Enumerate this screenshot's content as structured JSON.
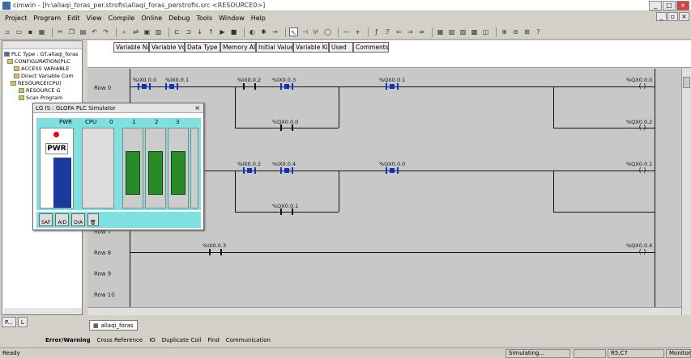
{
  "window": {
    "title": "cimwin - [h:\\allaqi_foras_per.strofis\\allaqi_foras_perstrofis.src <RESOURCE0>]"
  },
  "menu": [
    "Project",
    "Program",
    "Edit",
    "View",
    "Compile",
    "Online",
    "Debug",
    "Tools",
    "Window",
    "Help"
  ],
  "tree": {
    "nodes": [
      "PLC Type : GT.allaqi_foras",
      "CONFIGURATION(PLC",
      "ACCESS VARIABLE",
      "Direct Variable Com",
      "RESOURCE(CPU)",
      "RESOURCE G",
      "Scan Program"
    ],
    "tabs": [
      "P...",
      "L"
    ]
  },
  "header_cols": [
    "Variable Na",
    "Variable Vc",
    "Data Type",
    "Memory Al",
    "Initial Value",
    "Variable Ki",
    "Used",
    "Comments"
  ],
  "ladder": {
    "rungs": [
      "Row 0",
      "Row 7",
      "Row 8",
      "Row 9",
      "Row 10"
    ],
    "labels": {
      "r0_c1": "%IX0.0.0",
      "r0_c2": "%IX0.0.1",
      "r0_c3": "%IX0.0.2",
      "r0_c4": "%IX0.0.3",
      "r0_c5": "%QX0.0.1",
      "r0_coil": "%QX0.0.0",
      "r1_c": "%QX0.0.0",
      "r1_coil": "%QX0.0.2",
      "r2_c1": "%IX0.0.2",
      "r2_c2": "%IX0.0.4",
      "r2_c3": "%QX0.0.0",
      "r2_coil": "%QX0.0.1",
      "r3_c": "%QX0.0.1",
      "r8_c": "%IX0.0.3",
      "r8_coil": "%QX0.0.4"
    }
  },
  "doc_tab": "allaqi_foras",
  "output_tabs": [
    "Error/Warning",
    "Cross Reference",
    "IO",
    "Duplicate Coil",
    "Find",
    "Communication"
  ],
  "status": {
    "left": "Ready",
    "mode": "Simulating...",
    "pos": "R5,C7",
    "right": "Monitor"
  },
  "simulator": {
    "title": "LG IS : GLOFA PLC Simulator",
    "slots": [
      "PWR",
      "CPU",
      "0",
      "1",
      "2",
      "3"
    ],
    "pwr_label": "PWR",
    "buttons": [
      "SAF",
      "A/D",
      "D/A"
    ]
  },
  "colors": {
    "active_contact": "#1030c0",
    "sim_bg": "#7fe0e0",
    "module_green": "#2a8a2a"
  }
}
